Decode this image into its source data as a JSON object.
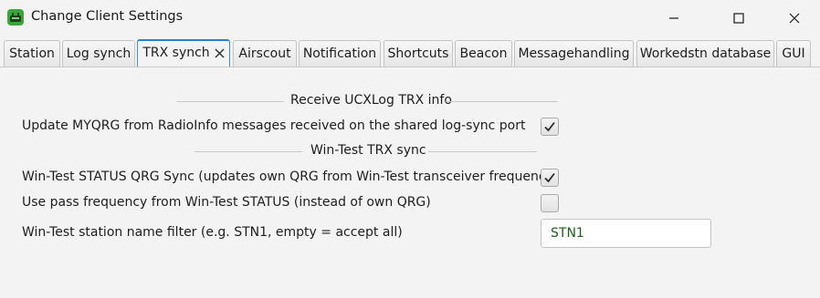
{
  "window": {
    "title": "Change Client Settings",
    "icon": "app-icon",
    "controls": [
      "minimize-icon",
      "maximize-icon",
      "close-icon"
    ]
  },
  "tabs": [
    {
      "label": "Station",
      "active": false
    },
    {
      "label": "Log synch",
      "active": false
    },
    {
      "label": "TRX synch",
      "active": true,
      "closable": true
    },
    {
      "label": "Airscout",
      "active": false
    },
    {
      "label": "Notification",
      "active": false
    },
    {
      "label": "Shortcuts",
      "active": false
    },
    {
      "label": "Beacon",
      "active": false
    },
    {
      "label": "Messagehandling",
      "active": false
    },
    {
      "label": "Workedstn database",
      "active": false
    },
    {
      "label": "GUI",
      "active": false
    }
  ],
  "sections": {
    "ucxlog": {
      "title": "Receive UCXLog TRX info",
      "update_myqrg": {
        "label": "Update MYQRG from RadioInfo messages received on the shared log-sync port",
        "checked": true
      }
    },
    "wintest": {
      "title": "Win-Test TRX sync",
      "status_sync": {
        "label": "Win-Test STATUS QRG Sync (updates own QRG from Win-Test transceiver frequency)",
        "checked": true
      },
      "pass_freq": {
        "label": "Use pass frequency from Win-Test STATUS (instead of own QRG)",
        "checked": false
      },
      "name_filter": {
        "label": "Win-Test station name filter (e.g. STN1, empty = accept all)",
        "value": "STN1"
      }
    }
  },
  "colors": {
    "accent": "#2b7fd0",
    "background": "#f3f3f3",
    "field_text": "#1d5e1d"
  }
}
